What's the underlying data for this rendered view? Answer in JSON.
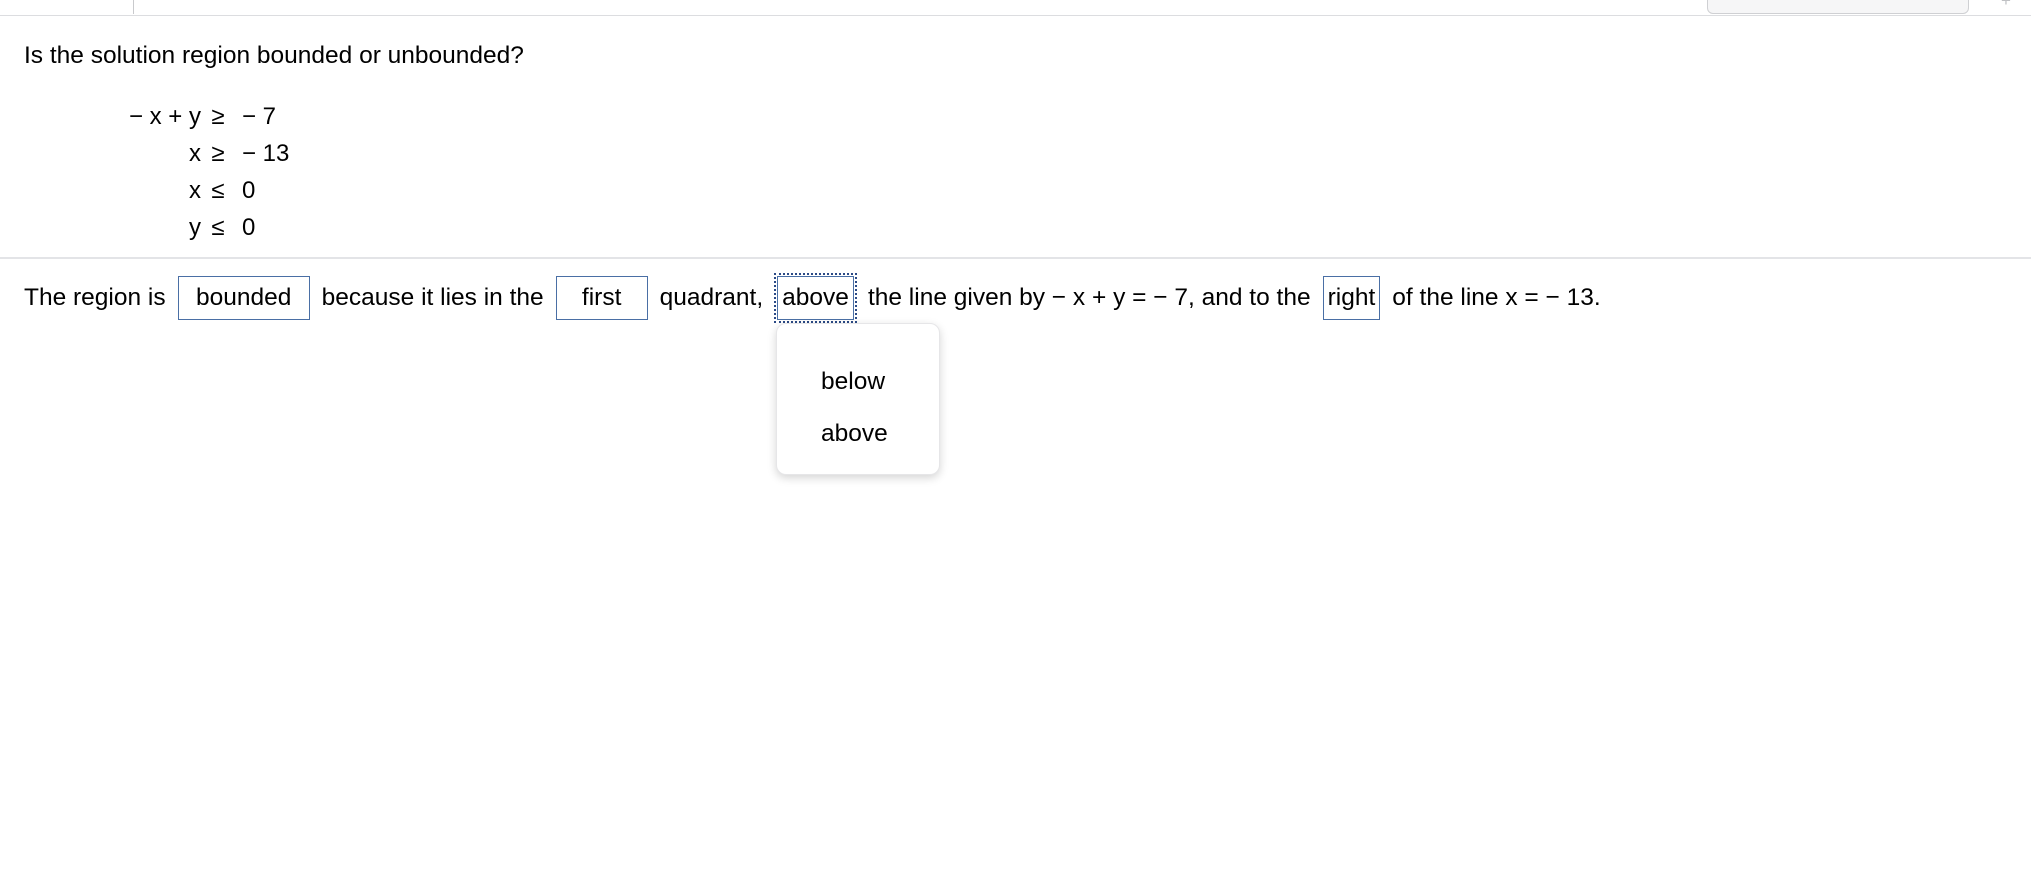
{
  "top_chrome": {
    "right_button_label": "",
    "plus_icon": "+"
  },
  "question": {
    "prompt": "Is the solution region bounded or unbounded?",
    "inequalities": [
      {
        "lhs": "− x + y",
        "op": "≥",
        "rhs": "− 7"
      },
      {
        "lhs": "x",
        "op": "≥",
        "rhs": "− 13"
      },
      {
        "lhs": "x",
        "op": "≤",
        "rhs": "0"
      },
      {
        "lhs": "y",
        "op": "≤",
        "rhs": "0"
      }
    ]
  },
  "answer": {
    "seg1": "The region is",
    "field_bounded": "bounded",
    "seg2": "because it lies in the",
    "field_quadrant": "first",
    "seg3": "quadrant,",
    "field_position": "above",
    "seg4": "the line given by − x + y = − 7, and to the",
    "field_side": "right",
    "seg5": "of the line x = − 13."
  },
  "dropdown": {
    "options": [
      {
        "label": "below"
      },
      {
        "label": "above"
      }
    ]
  },
  "colors": {
    "field_border": "#4a6fa5",
    "focus_outline": "#2b4a86",
    "separator": "#e3e4e7"
  }
}
